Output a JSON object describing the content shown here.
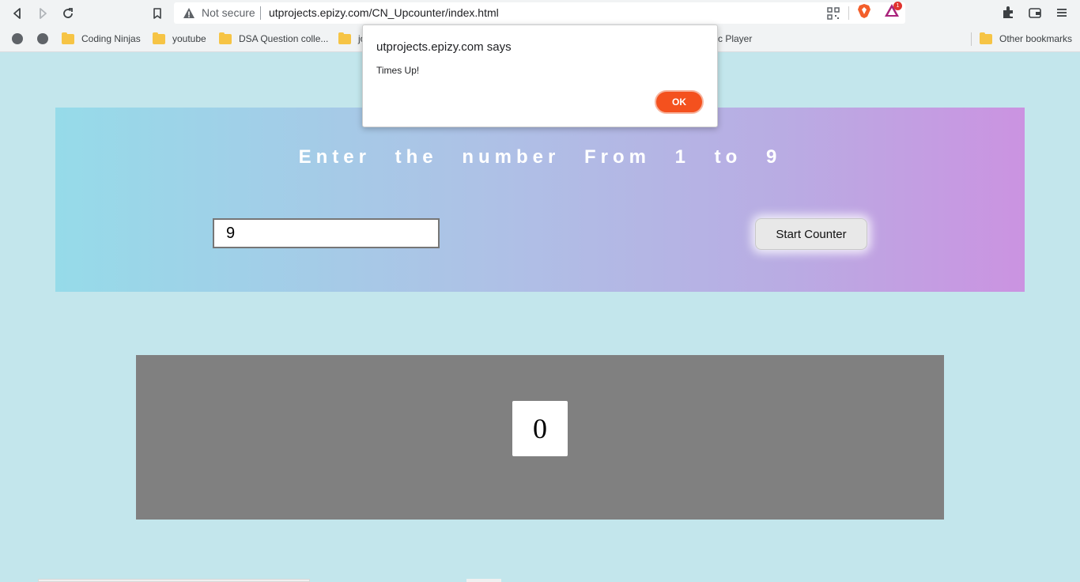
{
  "browser": {
    "security_label": "Not secure",
    "url": "utprojects.epizy.com/CN_Upcounter/index.html",
    "rewards_badge": "1",
    "icons": [
      "back-icon",
      "forward-icon",
      "reload-icon",
      "bookmark-icon",
      "warning-icon",
      "qr-code-icon",
      "brave-shield-icon",
      "brave-rewards-icon",
      "extensions-icon",
      "wallet-icon",
      "menu-icon"
    ]
  },
  "bookmarks": {
    "items": [
      {
        "label": "Coding Ninjas"
      },
      {
        "label": "youtube"
      },
      {
        "label": "DSA Question colle..."
      },
      {
        "label": "jo"
      },
      {
        "label": "c Player"
      }
    ],
    "other": "Other bookmarks"
  },
  "page": {
    "heading": "Enter the number From 1 to 9",
    "input_value": "9",
    "start_button": "Start Counter",
    "counter_value": "0"
  },
  "dialog": {
    "title": "utprojects.epizy.com says",
    "message": "Times Up!",
    "ok_label": "OK"
  },
  "colors": {
    "page_bg": "#c3e6ec",
    "gradient_start": "#96dbe9",
    "gradient_end": "#cb93e1",
    "counter_panel": "#808080",
    "ok_button": "#f4511e"
  }
}
